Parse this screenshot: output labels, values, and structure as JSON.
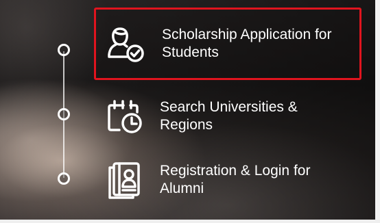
{
  "menu": {
    "items": [
      {
        "label": "Scholarship Application for Students",
        "icon": "user-check-icon",
        "highlighted": true
      },
      {
        "label": "Search Universities & Regions",
        "icon": "calendar-clock-icon",
        "highlighted": false
      },
      {
        "label": "Registration & Login for Alumni",
        "icon": "id-card-icon",
        "highlighted": false
      }
    ]
  },
  "colors": {
    "highlight_border": "#e0141e",
    "text": "#ffffff",
    "frame": "#f2f2f2"
  }
}
